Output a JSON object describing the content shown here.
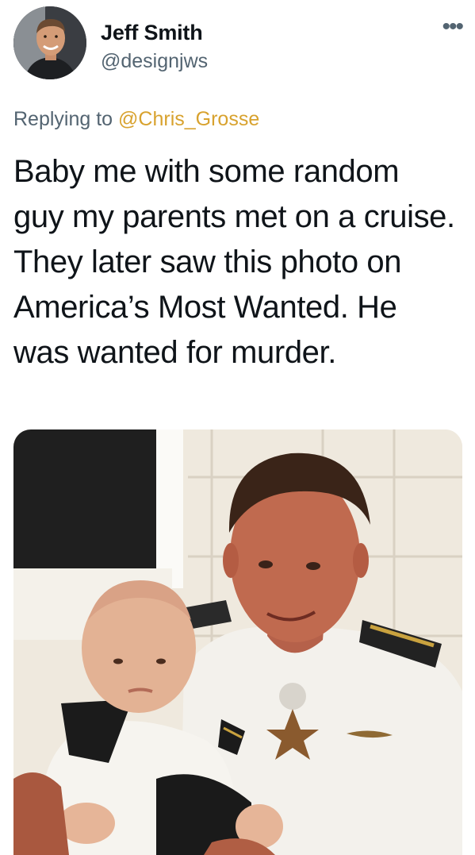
{
  "author": {
    "name": "Jeff Smith",
    "handle": "@designjws"
  },
  "menu_icon": "more-dots-icon",
  "reply": {
    "prefix": "Replying to ",
    "mention": "@Chris_Grosse"
  },
  "tweet": {
    "text": "Baby me with some random guy my parents met on a cruise. They later saw this photo on America’s Most Wanted. He was wanted for murder."
  },
  "colors": {
    "mention": "#d8a22e",
    "secondary_text": "#536471"
  }
}
